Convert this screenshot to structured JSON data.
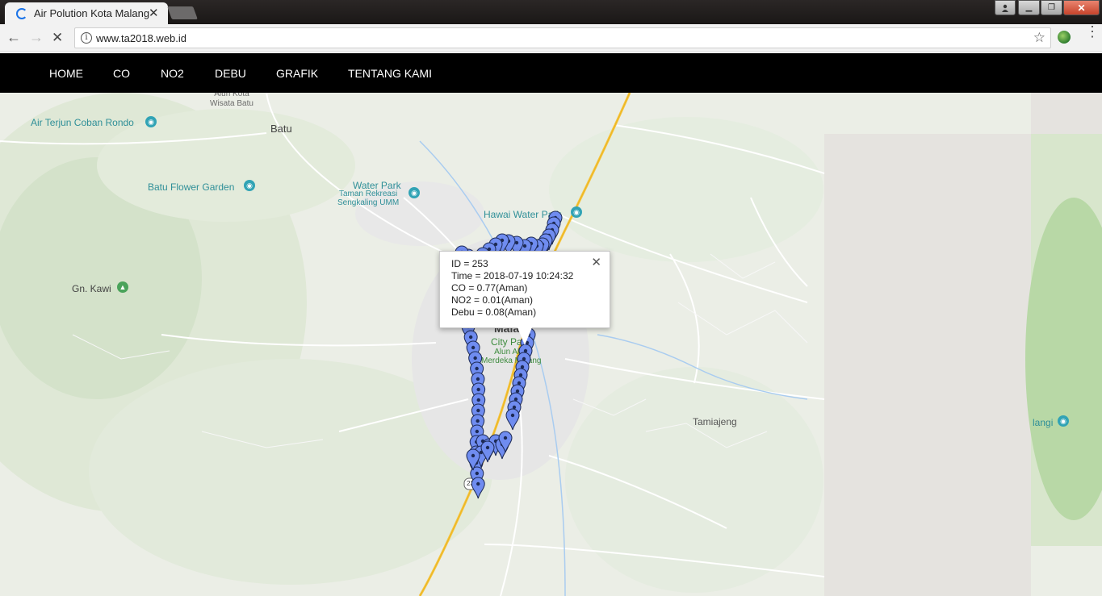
{
  "browser": {
    "tab_title": "Air Polution Kota Malang",
    "tab_close": "✕",
    "url": "www.ta2018.web.id",
    "window_buttons": {
      "minimize": "▁",
      "maximize": "❐",
      "close": "✕"
    }
  },
  "navbar": {
    "items": [
      {
        "label": "HOME"
      },
      {
        "label": "CO"
      },
      {
        "label": "NO2"
      },
      {
        "label": "DEBU"
      },
      {
        "label": "GRAFIK"
      },
      {
        "label": "TENTANG KAMI"
      }
    ]
  },
  "map": {
    "places": [
      {
        "name": "Alun Kota\nWisata Batu"
      },
      {
        "name": "Air Terjun Coban Rondo"
      },
      {
        "name": "Batu"
      },
      {
        "name": "Batu Flower Garden"
      },
      {
        "name": "Water Park"
      },
      {
        "name": "Taman Rekreasi\nSengkaling UMM"
      },
      {
        "name": "Hawai Water Park"
      },
      {
        "name": "Gn. Kawi"
      },
      {
        "name": "City Park"
      },
      {
        "name": "Alun Alun\nMerdeka Malang"
      },
      {
        "name": "Tamiajeng"
      },
      {
        "name": "Malang"
      },
      {
        "name": "langi"
      }
    ],
    "road_shield": "23",
    "marker_color": "#6f8cf0"
  },
  "infowindow": {
    "id": "ID = 253",
    "time": "Time = 2018-07-19 10:24:32",
    "co": "CO = 0.77(Aman)",
    "no2": "NO2 = 0.01(Aman)",
    "debu": "Debu = 0.08(Aman)"
  }
}
